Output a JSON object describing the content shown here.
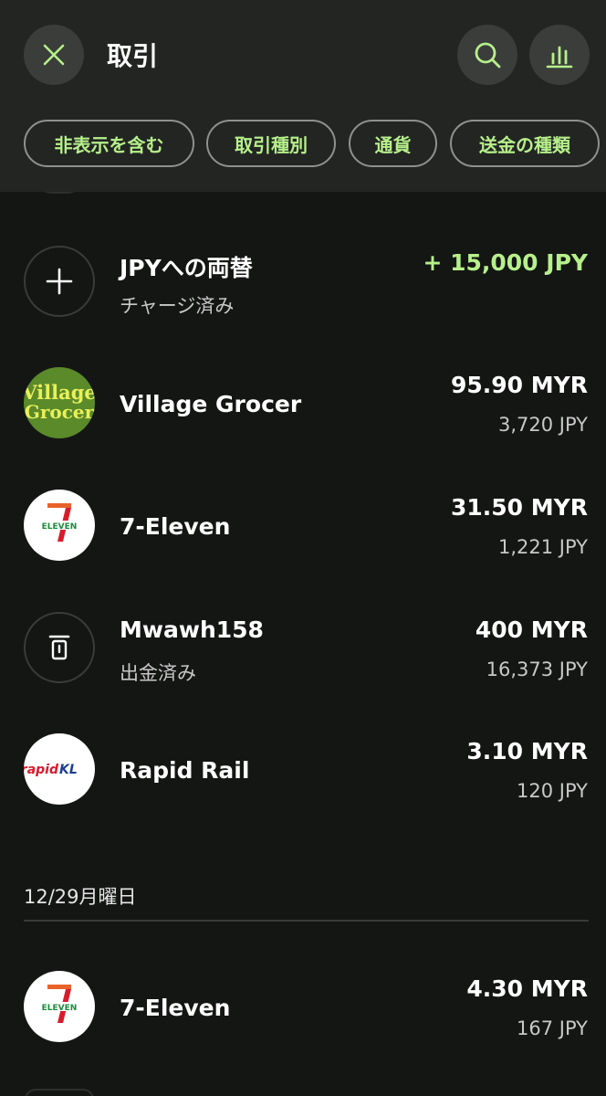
{
  "header": {
    "title": "取引",
    "filters": [
      "非表示を含む",
      "取引種別",
      "通貨",
      "送金の種類"
    ]
  },
  "transactions": [
    {
      "name": "JPYへの両替",
      "subtitle": "チャージ済み",
      "amount": "+ 15,000 JPY",
      "secondary": "",
      "icon": "plus-icon"
    },
    {
      "name": "Village Grocer",
      "subtitle": "",
      "amount": "95.90 MYR",
      "secondary": "3,720 JPY",
      "icon": "village-grocer-logo"
    },
    {
      "name": "7-Eleven",
      "subtitle": "",
      "amount": "31.50 MYR",
      "secondary": "1,221 JPY",
      "icon": "seven-eleven-logo"
    },
    {
      "name": "Mwawh158",
      "subtitle": "出金済み",
      "amount": "400 MYR",
      "secondary": "16,373 JPY",
      "icon": "withdraw-icon"
    },
    {
      "name": "Rapid Rail",
      "subtitle": "",
      "amount": "3.10 MYR",
      "secondary": "120 JPY",
      "icon": "rapid-kl-logo"
    }
  ],
  "section2": {
    "date": "12/29月曜日",
    "transactions": [
      {
        "name": "7-Eleven",
        "amount": "4.30 MYR",
        "secondary": "167 JPY",
        "icon": "seven-eleven-logo"
      }
    ]
  },
  "logos": {
    "village_line1": "Village",
    "village_line2": "Grocer",
    "eleven_text": "ELEVEN",
    "seven": "7",
    "rapid_text": "rapid",
    "kl_text": "KL"
  },
  "colors": {
    "accent": "#b6f08a",
    "background": "#141614",
    "header": "#232523"
  }
}
